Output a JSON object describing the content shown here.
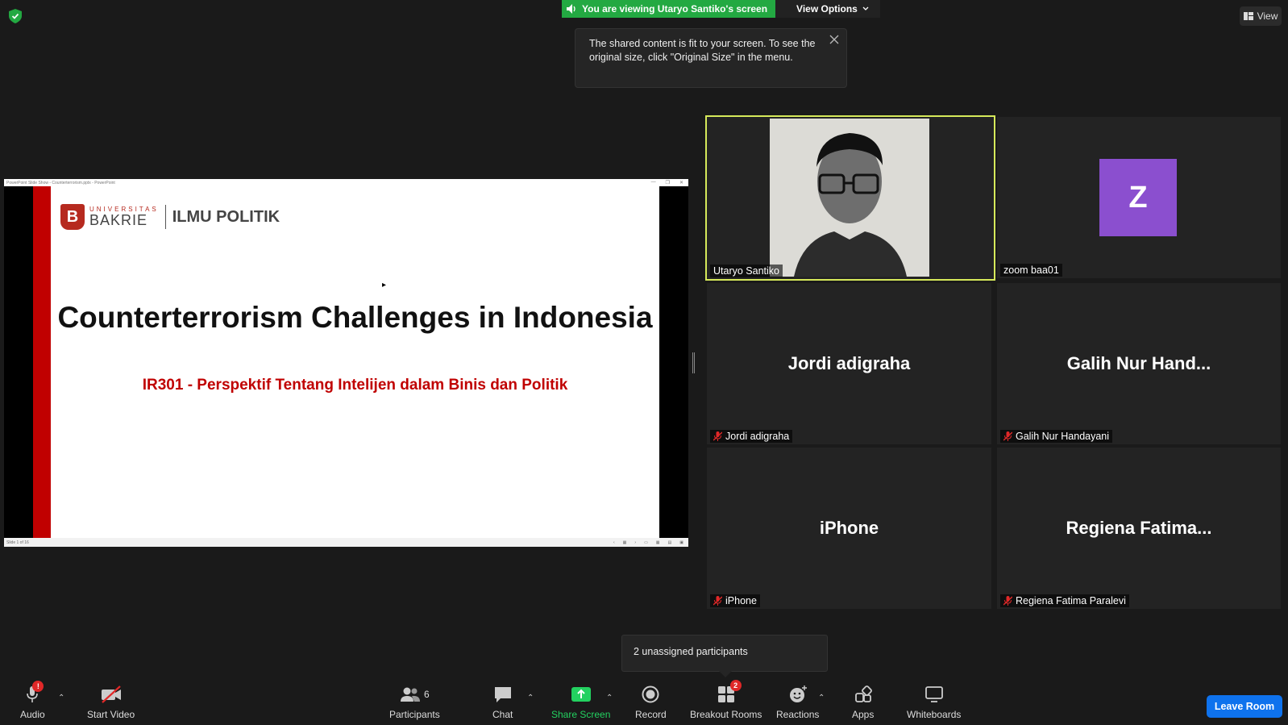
{
  "banner": {
    "viewing_text": "You are viewing Utaryo Santiko's screen",
    "view_options_label": "View Options"
  },
  "tooltip": {
    "text": "The shared content is fit to your screen. To see the original size, click \"Original Size\" in the menu."
  },
  "view_button_label": "View",
  "shared_screen": {
    "titlebar": "PowerPoint Slide Show - Counterterrorism.pptx - PowerPoint",
    "status": "Slide 1 of 16",
    "slide": {
      "logo_small": "UNIVERSITAS",
      "logo_big": "BAKRIE",
      "logo_letter": "B",
      "logo_dept": "ILMU POLITIK",
      "title": "Counterterrorism Challenges in Indonesia",
      "subtitle": "IR301 - Perspektif Tentang Intelijen dalam Binis dan Politik"
    }
  },
  "participants_tiles": [
    {
      "name": "Utaryo Santiko",
      "muted": false,
      "active": true
    },
    {
      "name": "zoom baa01",
      "avatar_letter": "Z",
      "muted": false
    },
    {
      "name": "Jordi adigraha",
      "big_name": "Jordi adigraha",
      "muted": true
    },
    {
      "name": "Galih Nur Handayani",
      "big_name": "Galih Nur Hand...",
      "muted": true
    },
    {
      "name": "iPhone",
      "big_name": "iPhone",
      "muted": true
    },
    {
      "name": "Regiena Fatima Paralevi",
      "big_name": "Regiena Fatima...",
      "muted": true
    }
  ],
  "unassigned_tooltip": "2 unassigned participants",
  "toolbar": {
    "audio": "Audio",
    "start_video": "Start Video",
    "participants": "Participants",
    "participants_count": "6",
    "chat": "Chat",
    "share_screen": "Share Screen",
    "record": "Record",
    "breakout_rooms": "Breakout Rooms",
    "breakout_badge": "2",
    "reactions": "Reactions",
    "apps": "Apps",
    "whiteboards": "Whiteboards",
    "leave_room": "Leave Room"
  },
  "colors": {
    "share_green": "#23a942",
    "active_border": "#d6e95a",
    "leave_blue": "#0e72ed",
    "avatar_purple": "#8b4fcf",
    "slide_red": "#c00000"
  }
}
